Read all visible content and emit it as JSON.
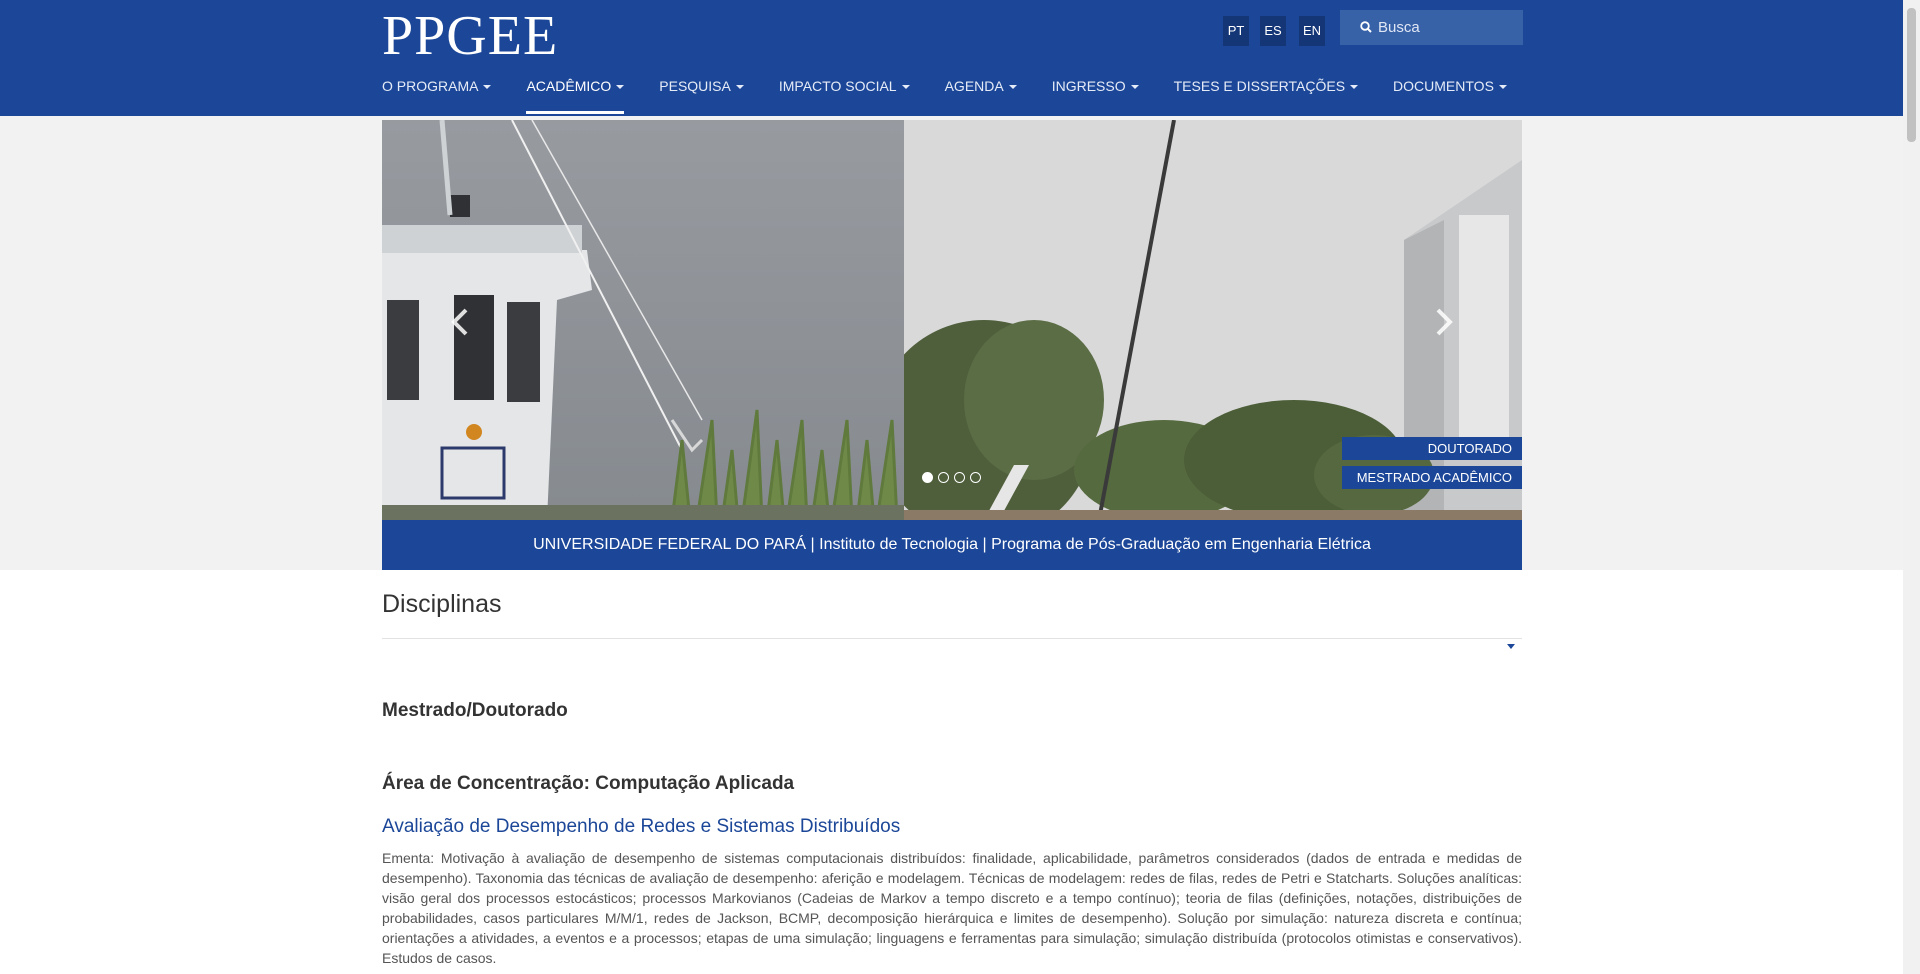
{
  "header": {
    "logo": "PPGEE",
    "languages": [
      "PT",
      "ES",
      "EN"
    ],
    "search_placeholder": "Busca"
  },
  "nav": [
    {
      "label": "O PROGRAMA",
      "active": false
    },
    {
      "label": "ACADÊMICO",
      "active": true
    },
    {
      "label": "PESQUISA",
      "active": false
    },
    {
      "label": "IMPACTO SOCIAL",
      "active": false
    },
    {
      "label": "AGENDA",
      "active": false
    },
    {
      "label": "INGRESSO",
      "active": false
    },
    {
      "label": "TESES E DISSERTAÇÕES",
      "active": false
    },
    {
      "label": "DOCUMENTOS",
      "active": false
    }
  ],
  "slider": {
    "captions": [
      "DOUTORADO",
      "MESTRADO ACADÊMICO"
    ],
    "slide_count": 4,
    "active_slide": 1,
    "footer": "UNIVERSIDADE FEDERAL DO PARÁ | Instituto de Tecnologia | Programa de Pós-Graduação em Engenharia Elétrica"
  },
  "content": {
    "title": "Disciplinas",
    "level": "Mestrado/Doutorado",
    "area": "Área de Concentração: Computação Aplicada",
    "course_title": "Avaliação de Desempenho de Redes e Sistemas Distribuídos",
    "ementa": "Ementa: Motivação à avaliação de desempenho de sistemas computacionais distribuídos: finalidade, aplicabilidade, parâmetros considerados (dados de entrada e medidas de desempenho). Taxonomia das técnicas de avaliação de desempenho: aferição e modelagem. Técnicas de modelagem: redes de filas, redes de Petri e Statcharts. Soluções analíticas: visão geral dos processos estocásticos; processos Markovianos (Cadeias de Markov a tempo discreto e a tempo contínuo); teoria de filas (definições, notações, distribuições de probabilidades, casos particulares M/M/1, redes de Jackson, BCMP, decomposição hierárquica e limites de desempenho). Solução por simulação: natureza discreta e contínua; orientações a atividades, a eventos e a processos; etapas de uma simulação; linguagens e ferramentas para simulação; simulação distribuída (protocolos otimistas e conservativos). Estudos de casos."
  },
  "colors": {
    "brand_blue": "#1c4798",
    "link_blue": "#1c4798",
    "band_gray": "#f2f2f2"
  },
  "icons": [
    "search-icon",
    "chevron-left-icon",
    "chevron-right-icon",
    "caret-down-icon"
  ]
}
